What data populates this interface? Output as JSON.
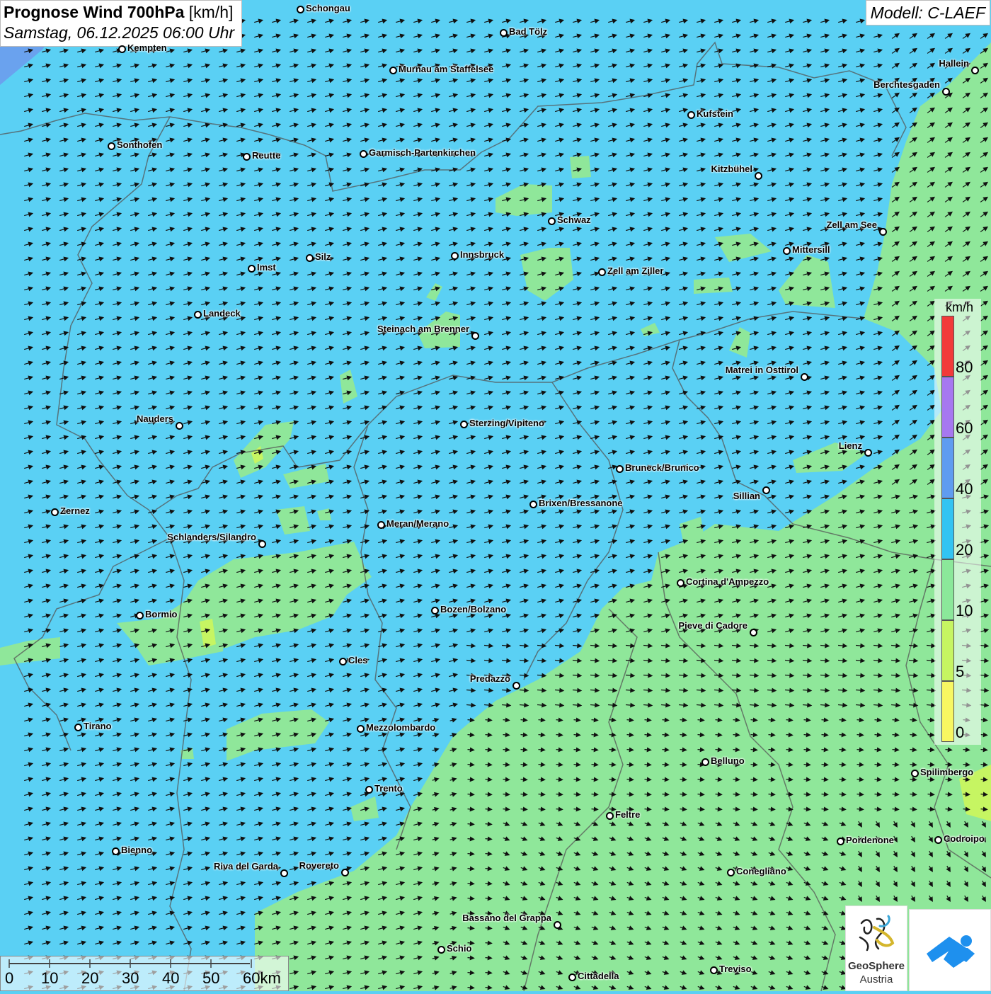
{
  "header": {
    "title_bold": "Prognose Wind 700hPa",
    "title_unit": "[km/h]",
    "subtitle": "Samstag, 06.12.2025 06:00 Uhr",
    "model": "Modell: C-LAEF"
  },
  "cities": [
    {
      "name": "Schongau"
    },
    {
      "name": "Bad Tölz"
    },
    {
      "name": "Kempten"
    },
    {
      "name": "Murnau am Staffelsee"
    },
    {
      "name": "Hallein"
    },
    {
      "name": "Berchtesgaden"
    },
    {
      "name": "Kufstein"
    },
    {
      "name": "Sonthofen"
    },
    {
      "name": "Reutte"
    },
    {
      "name": "Garmisch-Partenkirchen"
    },
    {
      "name": "Kitzbühel"
    },
    {
      "name": "Schwaz"
    },
    {
      "name": "Zell am See"
    },
    {
      "name": "Mittersill"
    },
    {
      "name": "Innsbruck"
    },
    {
      "name": "Zell am Ziller"
    },
    {
      "name": "Imst"
    },
    {
      "name": "Silz"
    },
    {
      "name": "Landeck"
    },
    {
      "name": "Steinach am Brenner"
    },
    {
      "name": "Matrei in Osttirol"
    },
    {
      "name": "Nauders"
    },
    {
      "name": "Sterzing/Vipiteno"
    },
    {
      "name": "Lienz"
    },
    {
      "name": "Bruneck/Brunico"
    },
    {
      "name": "Sillian"
    },
    {
      "name": "Zernez"
    },
    {
      "name": "Brixen/Bressanone"
    },
    {
      "name": "Meran/Merano"
    },
    {
      "name": "Schlanders/Silandro"
    },
    {
      "name": "Cortina d'Ampezzo"
    },
    {
      "name": "Bozen/Bolzano"
    },
    {
      "name": "Bormio"
    },
    {
      "name": "Pieve di Cadore"
    },
    {
      "name": "Cles"
    },
    {
      "name": "Predazzo"
    },
    {
      "name": "Tirano"
    },
    {
      "name": "Mezzolombardo"
    },
    {
      "name": "Belluno"
    },
    {
      "name": "Spilimbergo"
    },
    {
      "name": "Trento"
    },
    {
      "name": "Feltre"
    },
    {
      "name": "Pordenone"
    },
    {
      "name": "Codroipo"
    },
    {
      "name": "Bienno"
    },
    {
      "name": "Riva del Garda"
    },
    {
      "name": "Rovereto"
    },
    {
      "name": "Conegliano"
    },
    {
      "name": "Bassano del Grappa"
    },
    {
      "name": "Schio"
    },
    {
      "name": "Treviso"
    },
    {
      "name": "Cittadella"
    }
  ],
  "legend": {
    "unit": "km/h",
    "labels": [
      "80",
      "60",
      "40",
      "20",
      "10",
      "5",
      "0"
    ],
    "colors": [
      "#f23a3a",
      "#a678f0",
      "#5f9cf0",
      "#32c4f2",
      "#8be89a",
      "#c6f562",
      "#f7f762"
    ]
  },
  "scale": {
    "labels": [
      "0",
      "10",
      "20",
      "30",
      "40",
      "50",
      "60km"
    ]
  },
  "logos": {
    "geosphere_line1": "GeoSphere",
    "geosphere_line2": "Austria"
  },
  "colors": {
    "fast": "#5ad0f4",
    "slow": "#8fe79a",
    "slowest": "#c6f562"
  }
}
